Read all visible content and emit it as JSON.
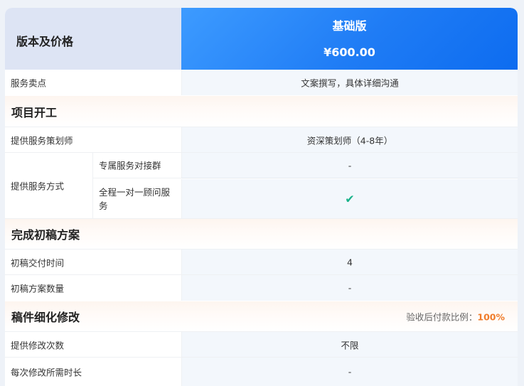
{
  "header": {
    "left_title": "版本及价格",
    "plan_name": "基础版",
    "plan_price": "¥600.00"
  },
  "rows": {
    "selling_point": {
      "label": "服务卖点",
      "value": "文案撰写，具体详细沟通"
    },
    "section_start": {
      "title": "项目开工"
    },
    "planner": {
      "label": "提供服务策划师",
      "value": "资深策划师（4-8年）"
    },
    "service_method": {
      "label": "提供服务方式",
      "sub1_label": "专属服务对接群",
      "sub1_value": "-",
      "sub2_label": "全程一对一顾问服务",
      "sub2_icon": "check-icon",
      "sub2_value": "✔"
    },
    "section_draft": {
      "title": "完成初稿方案"
    },
    "draft_time": {
      "label": "初稿交付时间",
      "value": "4"
    },
    "draft_count": {
      "label": "初稿方案数量",
      "value": "-"
    },
    "section_refine": {
      "title": "稿件细化修改",
      "note_prefix": "验收后付款比例：",
      "note_value": "100%"
    },
    "revision_count": {
      "label": "提供修改次数",
      "value": "不限"
    },
    "revision_time": {
      "label": "每次修改所需时长",
      "value": "-"
    }
  },
  "colors": {
    "header_blue": "#1f7cf5",
    "accent_orange": "#f07c2a",
    "check_green": "#19b28a"
  }
}
